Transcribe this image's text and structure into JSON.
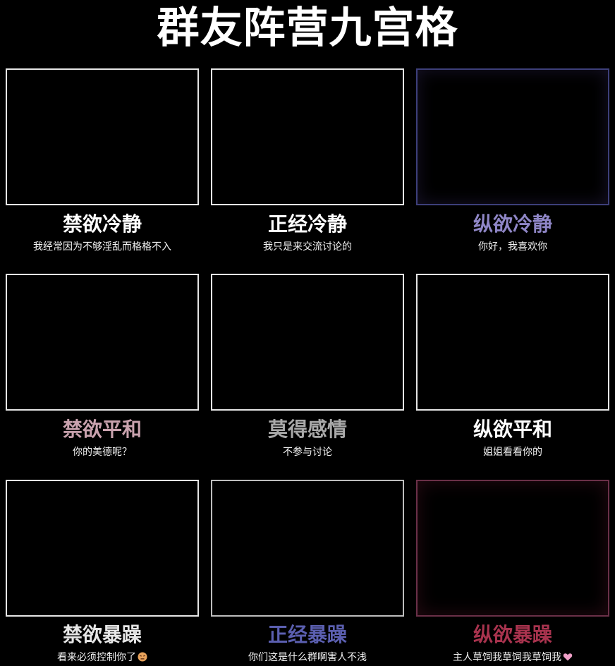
{
  "title": "群友阵营九宫格",
  "cells": [
    {
      "label": "禁欲冷静",
      "subtitle": "我经常因为不够淫乱而格格不入",
      "label_color": "#ffffff"
    },
    {
      "label": "正经冷静",
      "subtitle": "我只是来交流讨论的",
      "label_color": "#ffffff"
    },
    {
      "label": "纵欲冷静",
      "subtitle": "你好，我喜欢你",
      "label_color": "#8f86c6"
    },
    {
      "label": "禁欲平和",
      "subtitle": "你的美德呢？",
      "label_color": "#c9a2ae"
    },
    {
      "label": "莫得感情",
      "subtitle": "不参与讨论",
      "label_color": "#a9a9a9"
    },
    {
      "label": "纵欲平和",
      "subtitle": "姐姐看看你的",
      "label_color": "#ffffff"
    },
    {
      "label": "禁欲暴躁",
      "subtitle": "看来必须控制你了",
      "label_color": "#e6e6e6"
    },
    {
      "label": "正经暴躁",
      "subtitle": "你们这是什么群啊害人不浅",
      "label_color": "#5b5fb0"
    },
    {
      "label": "纵欲暴躁",
      "subtitle": "主人草饲我草饲我草饲我",
      "label_color": "#a8334e"
    }
  ],
  "icons": {
    "angry_face": "angry-face-emoji",
    "heart": "pink-heart-emoji"
  }
}
